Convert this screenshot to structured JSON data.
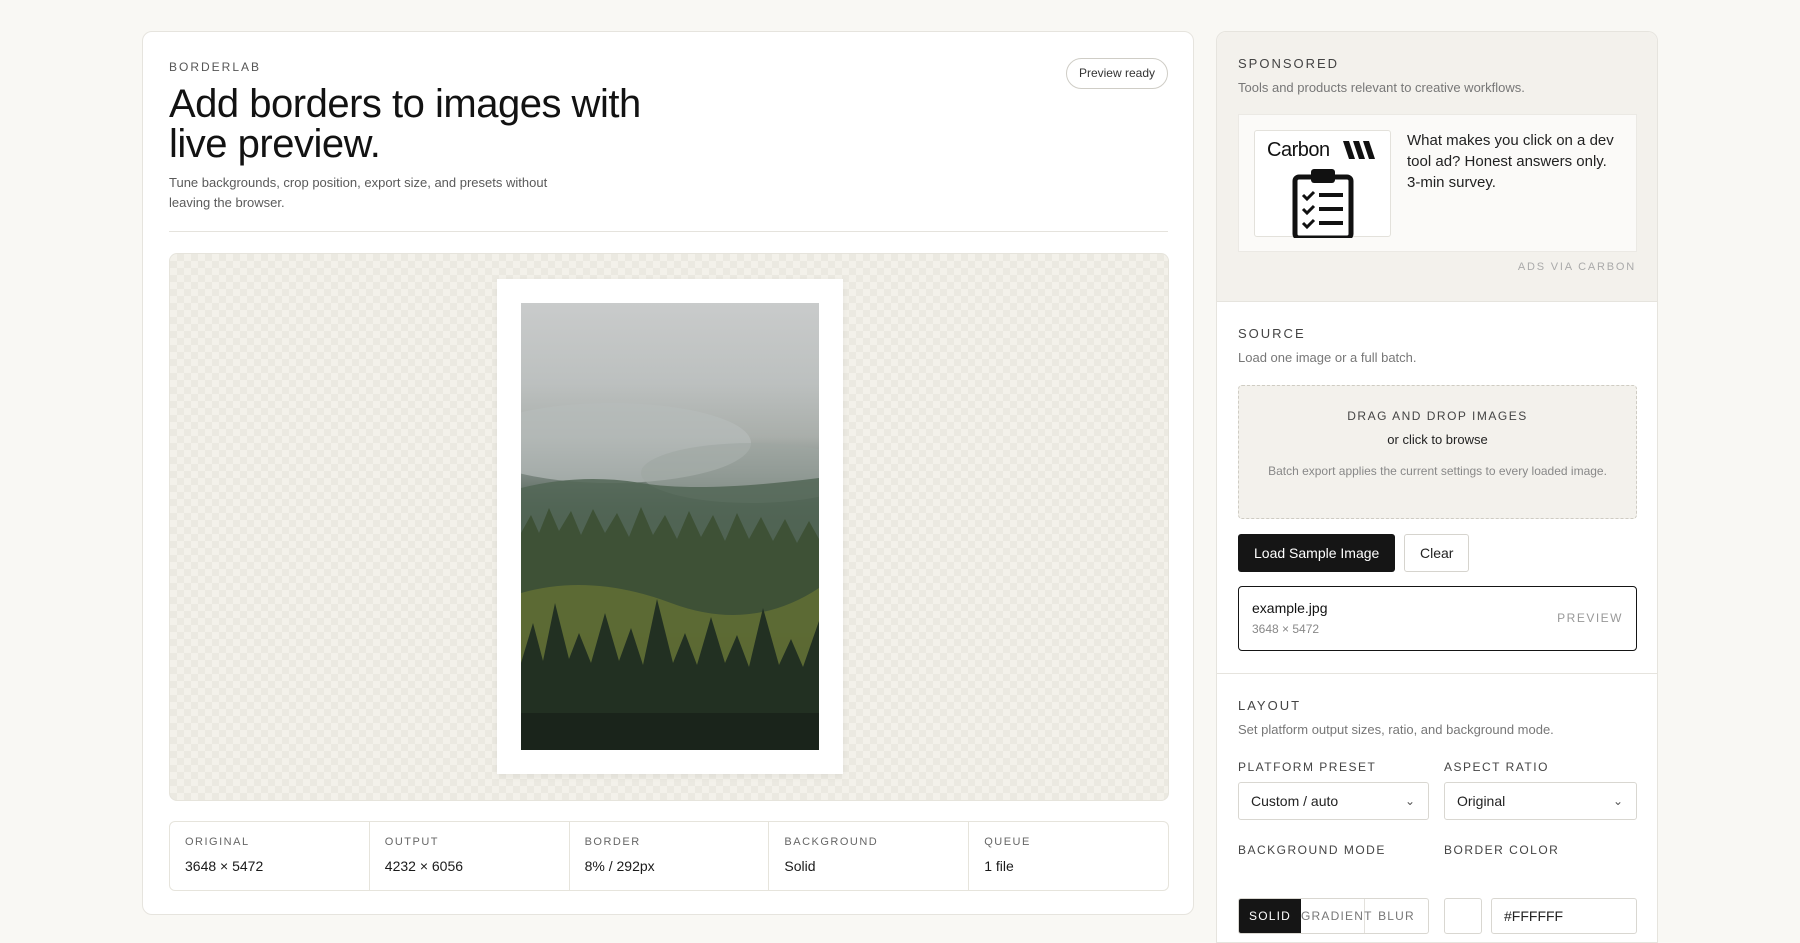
{
  "header": {
    "brand": "BORDERLAB",
    "status_pill": "Preview ready",
    "title": "Add borders to images with live preview.",
    "subtitle": "Tune backgrounds, crop position, export size, and presets without leaving the browser."
  },
  "preview": {
    "border_color": "#FFFFFF"
  },
  "stats": [
    {
      "label": "ORIGINAL",
      "value": "3648 × 5472"
    },
    {
      "label": "OUTPUT",
      "value": "4232 × 6056"
    },
    {
      "label": "BORDER",
      "value": "8% / 292px"
    },
    {
      "label": "BACKGROUND",
      "value": "Solid"
    },
    {
      "label": "QUEUE",
      "value": "1 file"
    }
  ],
  "sponsored": {
    "heading": "SPONSORED",
    "description": "Tools and products relevant to creative workflows.",
    "ad_brand": "Carbon",
    "ad_text": "What makes you click on a dev tool ad? Honest answers only. 3-min survey.",
    "ads_via": "ADS VIA CARBON"
  },
  "source": {
    "heading": "SOURCE",
    "description": "Load one image or a full batch.",
    "dropzone_title": "DRAG AND DROP IMAGES",
    "dropzone_sub": "or click to browse",
    "dropzone_note": "Batch export applies the current settings to every loaded image.",
    "load_button": "Load Sample Image",
    "clear_button": "Clear",
    "file_name": "example.jpg",
    "file_dims": "3648 × 5472",
    "file_action": "PREVIEW"
  },
  "layout": {
    "heading": "LAYOUT",
    "description": "Set platform output sizes, ratio, and background mode.",
    "platform_label": "PLATFORM PRESET",
    "platform_value": "Custom / auto",
    "aspect_label": "ASPECT RATIO",
    "aspect_value": "Original",
    "bg_mode_label": "BACKGROUND MODE",
    "bg_modes": [
      "SOLID",
      "GRADIENT",
      "BLUR"
    ],
    "border_color_label": "BORDER COLOR",
    "border_color_value": "#FFFFFF"
  },
  "icons": {
    "chevron": "chevron-down-icon",
    "clipboard": "clipboard-checklist-icon"
  }
}
